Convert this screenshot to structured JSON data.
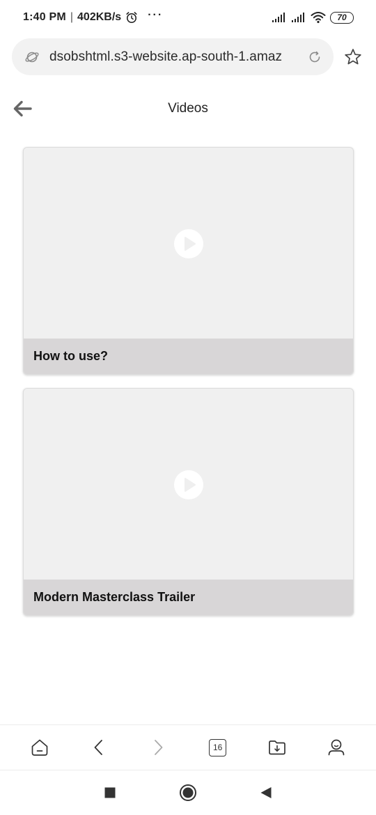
{
  "status_bar": {
    "time": "1:40 PM",
    "separator": "|",
    "speed": "402KB/s",
    "dots": "···",
    "battery": "70"
  },
  "browser": {
    "url": "dsobshtml.s3-website.ap-south-1.amaz"
  },
  "page": {
    "title": "Videos"
  },
  "videos": [
    {
      "title": "How to use?"
    },
    {
      "title": "Modern Masterclass Trailer"
    }
  ],
  "toolbar": {
    "tab_count": "16"
  },
  "colors": {
    "thumbnail_bg": "#f0f0f0",
    "caption_bg": "#d8d6d7",
    "url_bar_bg": "#f2f2f2"
  }
}
